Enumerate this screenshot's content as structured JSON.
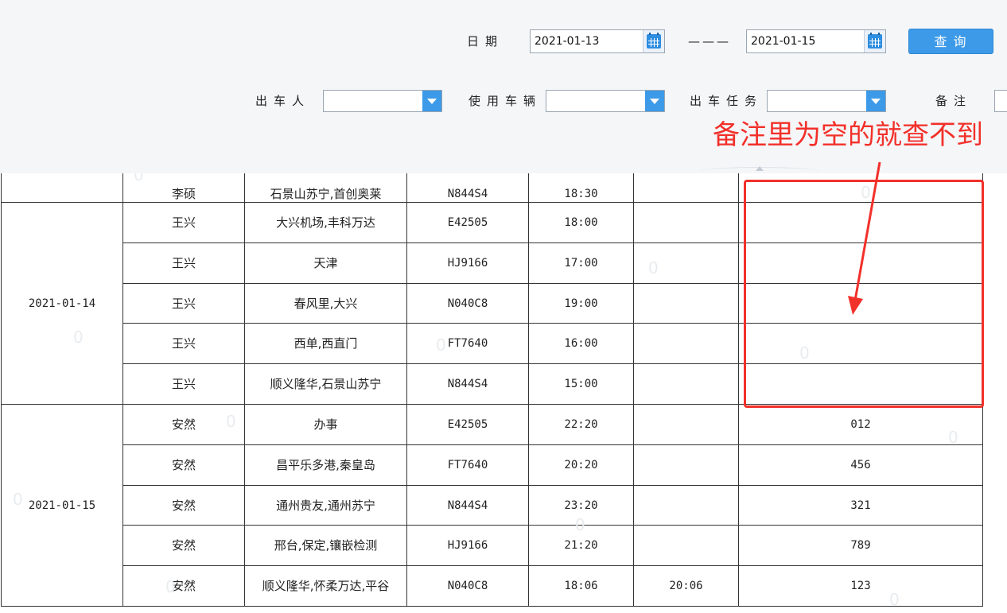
{
  "filters": {
    "date_label": "日期",
    "date_from": "2021-01-13",
    "date_sep": "———",
    "date_to": "2021-01-15",
    "query_label": "查询",
    "driver_label": "出车人",
    "driver_value": "",
    "vehicle_label": "使用车辆",
    "vehicle_value": "",
    "task_label": "出车任务",
    "task_value": "",
    "remark_label": "备注",
    "remark_value": ""
  },
  "annotation": {
    "text": "备注里为空的就查不到",
    "color": "#f2302a"
  },
  "table": {
    "groups": [
      {
        "date": "",
        "rows": [
          {
            "driver": "李硕",
            "route": "石景山苏宁,首创奥莱",
            "plate": "N844S4",
            "depart": "18:30",
            "return": "",
            "remark": ""
          }
        ]
      },
      {
        "date": "2021-01-14",
        "rows": [
          {
            "driver": "王兴",
            "route": "大兴机场,丰科万达",
            "plate": "E42505",
            "depart": "18:00",
            "return": "",
            "remark": ""
          },
          {
            "driver": "王兴",
            "route": "天津",
            "plate": "HJ9166",
            "depart": "17:00",
            "return": "",
            "remark": ""
          },
          {
            "driver": "王兴",
            "route": "春风里,大兴",
            "plate": "N040C8",
            "depart": "19:00",
            "return": "",
            "remark": ""
          },
          {
            "driver": "王兴",
            "route": "西单,西直门",
            "plate": "FT7640",
            "depart": "16:00",
            "return": "",
            "remark": ""
          },
          {
            "driver": "王兴",
            "route": "顺义隆华,石景山苏宁",
            "plate": "N844S4",
            "depart": "15:00",
            "return": "",
            "remark": ""
          }
        ]
      },
      {
        "date": "2021-01-15",
        "rows": [
          {
            "driver": "安然",
            "route": "办事",
            "plate": "E42505",
            "depart": "22:20",
            "return": "",
            "remark": "012"
          },
          {
            "driver": "安然",
            "route": "昌平乐多港,秦皇岛",
            "plate": "FT7640",
            "depart": "20:20",
            "return": "",
            "remark": "456"
          },
          {
            "driver": "安然",
            "route": "通州贵友,通州苏宁",
            "plate": "N844S4",
            "depart": "23:20",
            "return": "",
            "remark": "321"
          },
          {
            "driver": "安然",
            "route": "邢台,保定,镶嵌检测",
            "plate": "HJ9166",
            "depart": "21:20",
            "return": "",
            "remark": "789"
          },
          {
            "driver": "安然",
            "route": "顺义隆华,怀柔万达,平谷",
            "plate": "N040C8",
            "depart": "18:06",
            "return": "20:06",
            "remark": "123"
          }
        ]
      }
    ]
  }
}
